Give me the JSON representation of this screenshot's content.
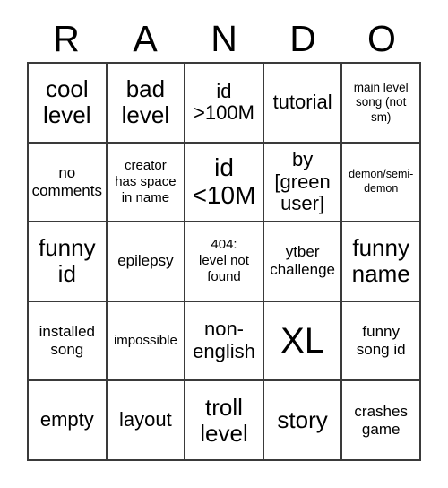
{
  "card": {
    "header_letters": [
      "R",
      "A",
      "N",
      "D",
      "O"
    ],
    "columns": 5,
    "rows": 5,
    "grid_border_color": "#3a3a3a",
    "background_color": "#ffffff",
    "text_color": "#000000",
    "cells": [
      {
        "text": "cool\nlevel",
        "size": "lg"
      },
      {
        "text": "bad\nlevel",
        "size": "lg"
      },
      {
        "text": "id\n>100M",
        "size": "md"
      },
      {
        "text": "tutorial",
        "size": "md"
      },
      {
        "text": "main level\nsong (not\nsm)",
        "size": "xxs"
      },
      {
        "text": "no\ncomments",
        "size": "sm"
      },
      {
        "text": "creator\nhas space\nin name",
        "size": "xs"
      },
      {
        "text": "id\n<10M",
        "size": "xl"
      },
      {
        "text": "by\n[green\nuser]",
        "size": "md"
      },
      {
        "text": "demon/semi-\ndemon",
        "size": "tiny"
      },
      {
        "text": "funny\nid",
        "size": "lg"
      },
      {
        "text": "epilepsy",
        "size": "sm"
      },
      {
        "text": "404:\nlevel not\nfound",
        "size": "xs"
      },
      {
        "text": "ytber\nchallenge",
        "size": "sm"
      },
      {
        "text": "funny\nname",
        "size": "lg"
      },
      {
        "text": "installed\nsong",
        "size": "sm"
      },
      {
        "text": "impossible",
        "size": "xs"
      },
      {
        "text": "non-\nenglish",
        "size": "md"
      },
      {
        "text": "XL",
        "size": "xxl"
      },
      {
        "text": "funny\nsong id",
        "size": "sm"
      },
      {
        "text": "empty",
        "size": "md"
      },
      {
        "text": "layout",
        "size": "md"
      },
      {
        "text": "troll\nlevel",
        "size": "lg"
      },
      {
        "text": "story",
        "size": "lg"
      },
      {
        "text": "crashes\ngame",
        "size": "sm"
      }
    ]
  }
}
